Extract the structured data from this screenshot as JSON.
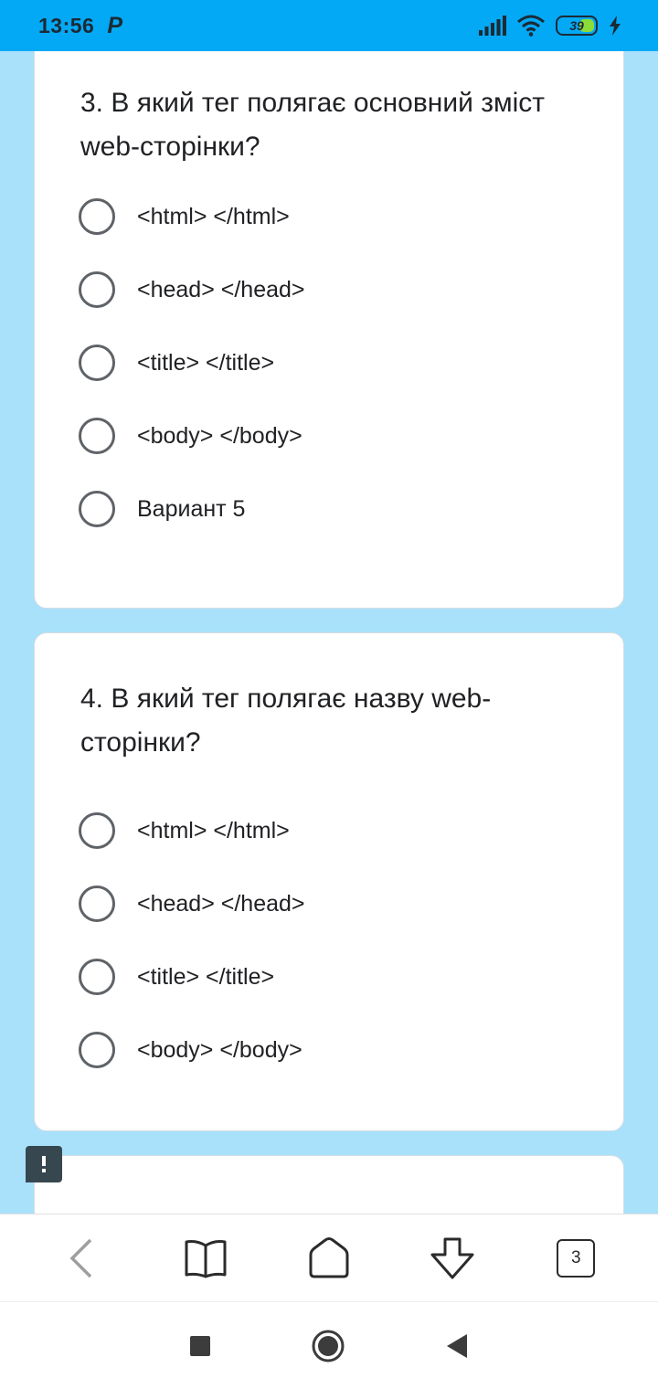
{
  "status_bar": {
    "time": "13:56",
    "app_glyph": "P",
    "battery": "39"
  },
  "questions": [
    {
      "title": "3. В який тег полягає основний зміст web-сторінки?",
      "options": [
        "<html> </html>",
        "<head> </head>",
        "<title> </title>",
        "<body> </body>",
        "Вариант 5"
      ]
    },
    {
      "title": "4. В який тег полягає назву web-сторінки?",
      "options": [
        "<html> </html>",
        "<head> </head>",
        "<title> </title>",
        "<body> </body>"
      ]
    }
  ],
  "browser_bar": {
    "tab_count": "3"
  },
  "icons": {
    "back": "chevron-left-icon",
    "bookmarks": "book-icon",
    "home": "home-icon",
    "download": "download-icon",
    "feedback": "feedback-icon"
  },
  "colors": {
    "status_bar": "#03a9f4",
    "page_bg": "#a9e1fb",
    "card_bg": "#ffffff",
    "radio": "#5f6368"
  }
}
